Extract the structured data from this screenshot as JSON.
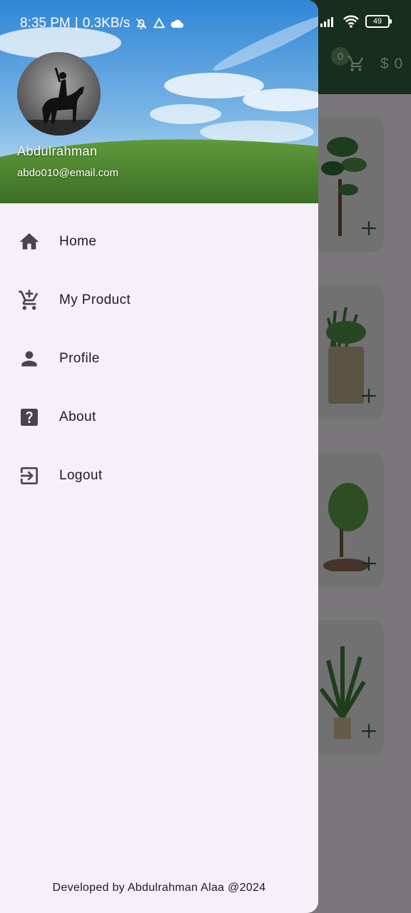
{
  "status_bar": {
    "time": "8:35 PM",
    "speed": "0.3KB/s",
    "battery": "49"
  },
  "app_bar": {
    "cart_count": "0",
    "total": "$ 0",
    "icons": [
      "cart-icon"
    ]
  },
  "drawer": {
    "user": {
      "name": "Abdulrahman",
      "email": "abdo010@email.com"
    },
    "items": [
      {
        "label": "Home",
        "icon": "home-icon"
      },
      {
        "label": "My Product",
        "icon": "add-shopping-cart-icon"
      },
      {
        "label": "Profile",
        "icon": "person-icon"
      },
      {
        "label": "About",
        "icon": "help-icon"
      },
      {
        "label": "Logout",
        "icon": "logout-icon"
      }
    ],
    "footer": "Developed by Abdulrahman Alaa @2024"
  },
  "colors": {
    "app_bar": "#2f5a3a",
    "drawer_bg": "#f6f0f8",
    "icon": "#49454f",
    "scrim": "rgba(0,0,0,0.5)"
  }
}
